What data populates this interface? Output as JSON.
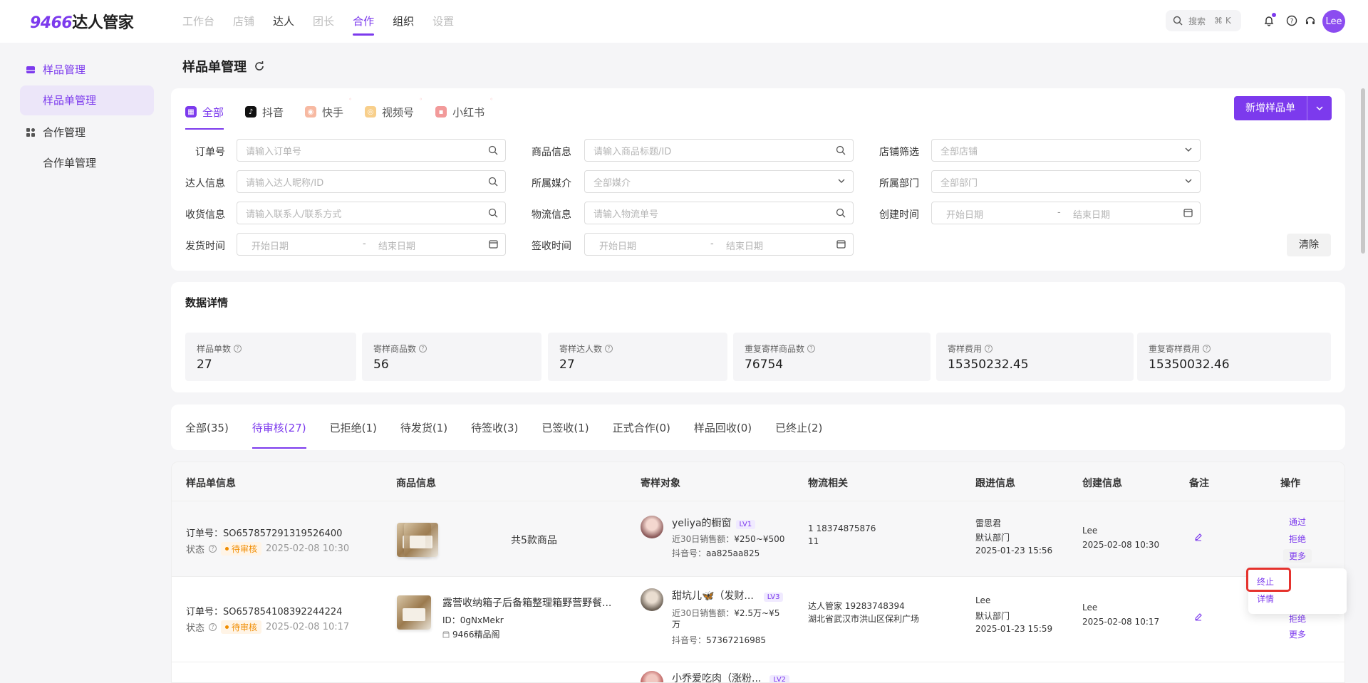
{
  "app": {
    "logo_num": "9466",
    "logo_text": "达人管家"
  },
  "topnav": {
    "items": [
      "工作台",
      "店铺",
      "达人",
      "团长",
      "合作",
      "组织",
      "设置"
    ],
    "search_label": "搜索",
    "search_kbd": "⌘ K",
    "user_initials": "Lee"
  },
  "sidebar": {
    "group1": "样品管理",
    "group1_item": "样品单管理",
    "group2": "合作管理",
    "group2_item": "合作单管理"
  },
  "page": {
    "title": "样品单管理"
  },
  "platforms": {
    "tabs": [
      "全部",
      "抖音",
      "快手",
      "视频号",
      "小红书"
    ],
    "new_button": "新增样品单"
  },
  "filters": {
    "order_no": {
      "label": "订单号",
      "placeholder": "请输入订单号"
    },
    "product_info": {
      "label": "商品信息",
      "placeholder": "请输入商品标题/ID"
    },
    "shop_filter": {
      "label": "店铺筛选",
      "placeholder": "全部店铺"
    },
    "talent_info": {
      "label": "达人信息",
      "placeholder": "请输入达人昵称/ID"
    },
    "media": {
      "label": "所属媒介",
      "placeholder": "全部媒介"
    },
    "department": {
      "label": "所属部门",
      "placeholder": "全部部门"
    },
    "receiver": {
      "label": "收货信息",
      "placeholder": "请输入联系人/联系方式"
    },
    "logistics": {
      "label": "物流信息",
      "placeholder": "请输入物流单号"
    },
    "created_time": {
      "label": "创建时间",
      "start": "开始日期",
      "end": "结束日期"
    },
    "ship_time": {
      "label": "发货时间",
      "start": "开始日期",
      "end": "结束日期"
    },
    "sign_time": {
      "label": "签收时间",
      "start": "开始日期",
      "end": "结束日期"
    },
    "date_sep": "-",
    "clear_button": "清除"
  },
  "stats": {
    "title": "数据详情",
    "items": [
      {
        "label": "样品单数",
        "value": "27"
      },
      {
        "label": "寄样商品数",
        "value": "56"
      },
      {
        "label": "寄样达人数",
        "value": "27"
      },
      {
        "label": "重复寄样商品数",
        "value": "76754"
      },
      {
        "label": "寄样费用",
        "value": "15350232.45"
      },
      {
        "label": "重复寄样费用",
        "value": "15350032.46"
      }
    ]
  },
  "status_tabs": [
    "全部(35)",
    "待审核(27)",
    "已拒绝(1)",
    "待发货(1)",
    "待签收(3)",
    "已签收(1)",
    "正式合作(0)",
    "样品回收(0)",
    "已终止(2)"
  ],
  "table": {
    "headers": [
      "样品单信息",
      "商品信息",
      "寄样对象",
      "物流相关",
      "跟进信息",
      "创建信息",
      "备注",
      "操作"
    ],
    "rows": [
      {
        "order_label": "订单号：",
        "order_no": "SO657857291319526400",
        "status_label": "状态",
        "status": "待审核",
        "status_time": "2025-02-08 10:30",
        "product_summary": "共5款商品",
        "talent_name": "yeliya的橱窗",
        "talent_level": "LV1",
        "sales_label": "近30日销售额：",
        "sales_value": "¥250~¥500",
        "dy_label": "抖音号：",
        "dy_value": "aa825aa825",
        "logistics_line1": "1  18374875876",
        "logistics_line2": "11",
        "follow_name": "雷思君",
        "follow_dept": "默认部门",
        "follow_time": "2025-01-23 15:56",
        "creator": "Lee",
        "created_time": "2025-02-08 10:30",
        "actions": [
          "通过",
          "拒绝",
          "更多"
        ]
      },
      {
        "order_label": "订单号：",
        "order_no": "SO657854108392244224",
        "status_label": "状态",
        "status": "待审核",
        "status_time": "2025-02-08 10:17",
        "product_title": "露营收纳箱子后备箱整理箱野营野餐...",
        "product_id": "ID：0gNxMekr",
        "product_shop": "9466精品阁",
        "talent_name": "甜坑儿🦋（发财...",
        "talent_level": "LV3",
        "sales_label": "近30日销售额：",
        "sales_value": "¥2.5万~¥5",
        "sales_value_cont": "万",
        "dy_label": "抖音号：",
        "dy_value": "57367216985",
        "logistics_line1": "达人管家  19283748394",
        "logistics_line2": "湖北省武汉市洪山区保利广场",
        "follow_name": "Lee",
        "follow_dept": "默认部门",
        "follow_time": "2025-01-23 15:59",
        "creator": "Lee",
        "created_time": "2025-02-08 10:17",
        "actions": [
          "拒绝",
          "更多"
        ]
      },
      {
        "talent_name": "小乔爱吃肉（涨粉...",
        "talent_level": "LV2"
      }
    ]
  },
  "more_menu": [
    "终止",
    "详情"
  ],
  "colors": {
    "accent": "#7c3aed",
    "pending": "#f08c00",
    "highlight": "#e5322d"
  }
}
